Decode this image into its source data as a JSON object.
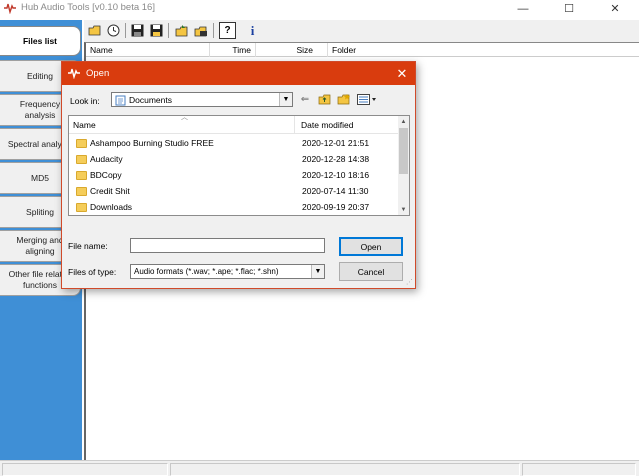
{
  "app": {
    "title": "Hub Audio Tools [v0.10 beta 16]",
    "window_controls": [
      "—",
      "☐",
      "✕"
    ]
  },
  "sidebar": {
    "tabs": [
      {
        "label": "Files list",
        "active": true
      },
      {
        "label": "Editing"
      },
      {
        "label": "Frequency analysis"
      },
      {
        "label": "Spectral analysis"
      },
      {
        "label": "MD5"
      },
      {
        "label": "Spliting"
      },
      {
        "label": "Merging and aligning"
      },
      {
        "label": "Other file related functions"
      }
    ]
  },
  "toolbar": {
    "icons": [
      "open-folder-icon",
      "clock-icon",
      "save-icon",
      "save-as-icon",
      "open-folder-arrow-icon",
      "open-folder-drive-icon",
      "help-icon",
      "info-icon"
    ],
    "help_glyph": "?",
    "info_glyph": "i"
  },
  "list": {
    "columns": [
      "Name",
      "Time",
      "Size",
      "Folder"
    ]
  },
  "dialog": {
    "title": "Open",
    "close_glyph": "✕",
    "look_in_label": "Look in:",
    "look_in_value": "Documents",
    "columns": [
      "Name",
      "Date modified"
    ],
    "folders": [
      {
        "name": "Ashampoo Burning Studio FREE",
        "date": "2020-12-01 21:51"
      },
      {
        "name": "Audacity",
        "date": "2020-12-28 14:38"
      },
      {
        "name": "BDCopy",
        "date": "2020-12-10 18:16"
      },
      {
        "name": "Credit Shit",
        "date": "2020-07-14 11:30"
      },
      {
        "name": "Downloads",
        "date": "2020-09-19 20:37"
      }
    ],
    "file_name_label": "File name:",
    "file_name_value": "",
    "files_of_type_label": "Files of type:",
    "files_of_type_value": "Audio formats (*.wav; *.ape; *.flac; *.shn)",
    "open_button": "Open",
    "cancel_button": "Cancel"
  },
  "colors": {
    "sidebar_blue": "#3f8fd6",
    "dialog_title_red": "#d93c0e"
  }
}
